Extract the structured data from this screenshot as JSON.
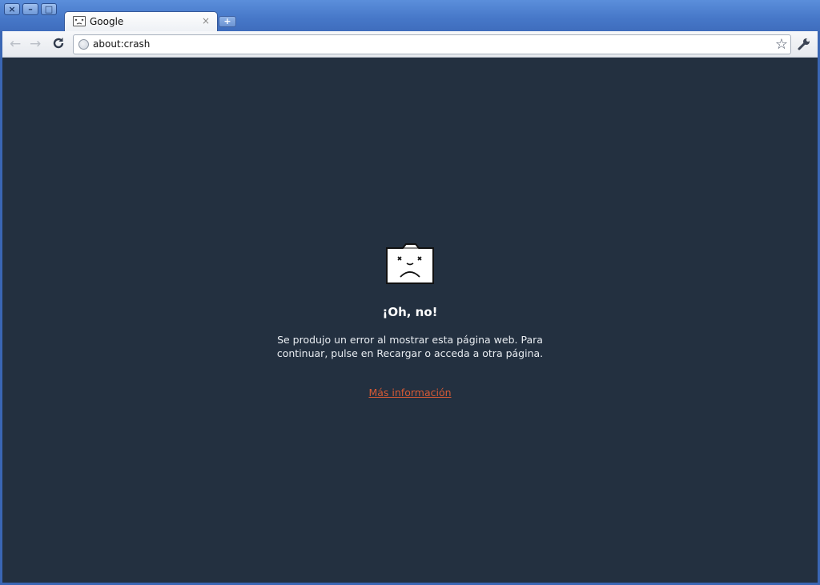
{
  "window": {
    "close_glyph": "×",
    "minimize_glyph": "–",
    "maximize_glyph": "□"
  },
  "tab": {
    "title": "Google",
    "close_glyph": "×"
  },
  "newtab": {
    "glyph": "+"
  },
  "toolbar": {
    "back_glyph": "←",
    "forward_glyph": "→",
    "reload_glyph": "C",
    "url": "about:crash",
    "star_glyph": "☆",
    "wrench_glyph": "🔧"
  },
  "content": {
    "background": "#233040",
    "icon": "sad-folder-icon",
    "headline": "¡Oh, no!",
    "message": "Se produjo un error al mostrar esta página web. Para continuar, pulse en Recargar o acceda a otra página.",
    "link_label": "Más información",
    "link_color": "#d65a35"
  }
}
